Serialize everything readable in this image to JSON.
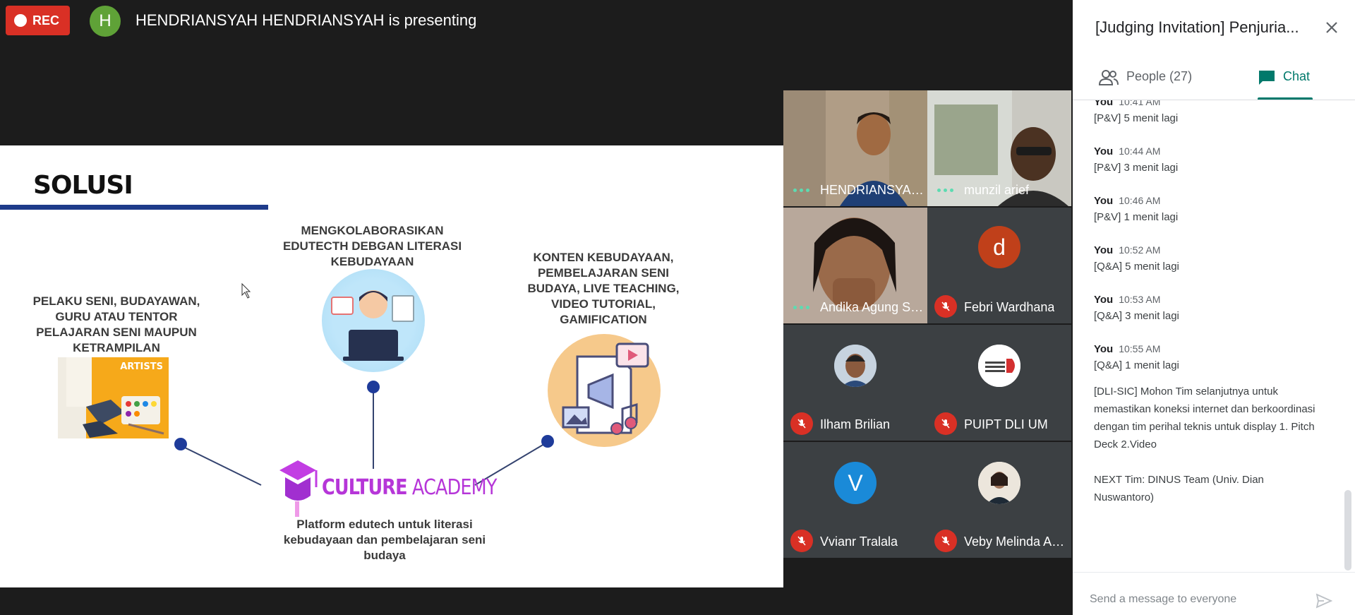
{
  "topbar": {
    "rec_label": "REC",
    "presenter_initial": "H",
    "presenter_text": "HENDRIANSYAH HENDRIANSYAH is presenting"
  },
  "slide": {
    "title": "SOLUSI",
    "caption_left": "PELAKU SENI, BUDAYAWAN, GURU ATAU TENTOR PELAJARAN SENI MAUPUN KETRAMPILAN",
    "caption_mid": "MENGKOLABORASIKAN EDUTECTH DEBGAN LITERASI KEBUDAYAAN",
    "caption_right": "KONTEN KEBUDAYAAN, PEMBELAJARAN SENI BUDAYA, LIVE TEACHING, VIDEO TUTORIAL, GAMIFICATION",
    "artists_label": "ARTISTS",
    "logo_word1": "CULTURE",
    "logo_word2": "ACADEMY",
    "caption_bottom": "Platform edutech untuk literasi kebudayaan dan pembelajaran seni budaya"
  },
  "participants": [
    {
      "name": "HENDRIANSYAH ...",
      "type": "video",
      "speaking": true
    },
    {
      "name": "munzil arief",
      "type": "video",
      "speaking": true
    },
    {
      "name": "Andika Agung Sut...",
      "type": "video",
      "speaking": true
    },
    {
      "name": "Febri Wardhana",
      "type": "avatar",
      "initial": "d",
      "color": "#c0401a",
      "muted": true
    },
    {
      "name": "Ilham Brilian",
      "type": "photo",
      "muted": true
    },
    {
      "name": "PUIPT DLI UM",
      "type": "photo",
      "muted": true
    },
    {
      "name": "Vvianr Tralala",
      "type": "avatar",
      "initial": "V",
      "color": "#1a8ad8",
      "muted": true
    },
    {
      "name": "Veby Melinda Ann...",
      "type": "photo",
      "muted": true
    }
  ],
  "panel": {
    "title": "[Judging Invitation] Penjuria...",
    "tab_people": "People (27)",
    "tab_chat": "Chat",
    "input_placeholder": "Send a message to everyone",
    "messages": [
      {
        "sender": "You",
        "time": "10:41 AM",
        "text": "[P&V] 5 menit lagi"
      },
      {
        "sender": "You",
        "time": "10:44 AM",
        "text": "[P&V] 3 menit lagi"
      },
      {
        "sender": "You",
        "time": "10:46 AM",
        "text": "[P&V]  1 menit lagi"
      },
      {
        "sender": "You",
        "time": "10:52 AM",
        "text": "[Q&A] 5 menit lagi"
      },
      {
        "sender": "You",
        "time": "10:53 AM",
        "text": "[Q&A] 3 menit lagi"
      },
      {
        "sender": "You",
        "time": "10:55 AM",
        "text": "[Q&A] 1 menit lagi"
      }
    ],
    "long_message_1": "[DLI-SIC] Mohon Tim selanjutnya untuk memastikan koneksi internet dan berkoordinasi dengan tim perihal teknis untuk display 1. Pitch Deck 2.Video",
    "long_message_2": "NEXT Tim: DINUS Team (Univ. Dian Nuswantoro)"
  },
  "colors": {
    "rec": "#d93025",
    "chat_accent": "#00796b",
    "slide_bar": "#1e3b8a",
    "logo": "#b636d8"
  }
}
